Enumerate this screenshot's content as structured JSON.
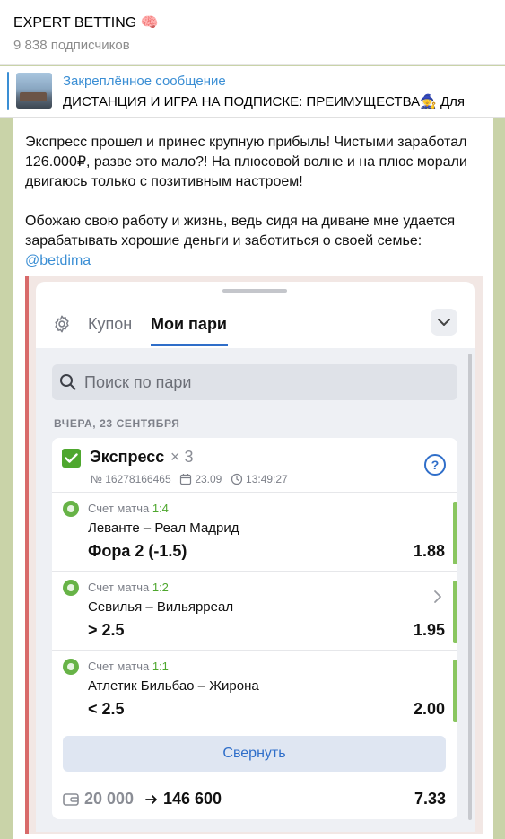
{
  "channel": {
    "title": "EXPERT BETTING 🧠",
    "subscribers": "9 838 подписчиков"
  },
  "pinned": {
    "label": "Закреплённое сообщение",
    "text": "ДИСТАНЦИЯ И ИГРА НА ПОДПИСКЕ: ПРЕИМУЩЕСТВА🧙 Для"
  },
  "message": {
    "paragraph1": "Экспресс прошел и принес крупную прибыль! Чистыми заработал 126.000₽, разве это мало?! На плюсовой волне и на плюс морали двигаюсь только с позитивным настроем!",
    "paragraph2": "Обожаю свою работу и жизнь, ведь сидя на диване мне удается зарабатывать хорошие деньги и заботиться о своей семье:",
    "mention": "@betdima"
  },
  "app": {
    "tabs": [
      "Купон",
      "Мои пари"
    ],
    "active_tab": "Мои пари",
    "search_placeholder": "Поиск по пари",
    "date_header": "ВЧЕРА, 23 СЕНТЯБРЯ",
    "express": {
      "title": "Экспресс",
      "count": "× 3",
      "number": "№ 16278166465",
      "date": "23.09",
      "time": "13:49:27",
      "help": "?"
    },
    "score_label": "Счет матча",
    "bets": [
      {
        "score": "1:4",
        "teams": "Леванте – Реал Мадрид",
        "market": "Фора 2 (-1.5)",
        "odds": "1.88"
      },
      {
        "score": "1:2",
        "teams": "Севилья – Вильярреал",
        "market": "> 2.5",
        "odds": "1.95"
      },
      {
        "score": "1:1",
        "teams": "Атлетик Бильбао – Жирона",
        "market": "< 2.5",
        "odds": "2.00"
      }
    ],
    "collapse_label": "Свернуть",
    "stake": "20 000",
    "payout": "146 600",
    "total_odds": "7.33"
  },
  "colors": {
    "accent": "#3a8ed4",
    "app_blue": "#2f6ec9",
    "win_green": "#4ea72e",
    "win_bar": "#8ac660"
  }
}
